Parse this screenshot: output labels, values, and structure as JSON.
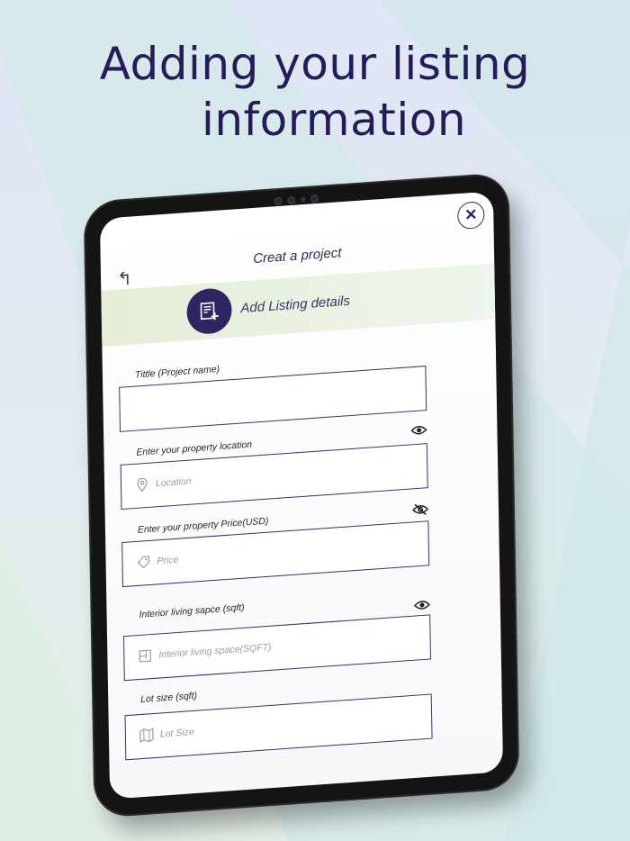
{
  "headline": {
    "line1": "Adding your listing",
    "line2": "information"
  },
  "screen": {
    "title": "Creat a project",
    "banner_text": "Add Listing details",
    "icons": {
      "close": "close-icon",
      "back": "back-arrow-icon",
      "banner": "listing-add-icon"
    }
  },
  "fields": [
    {
      "label": "Tittle (Project name)",
      "placeholder": "",
      "icon": ""
    },
    {
      "label": "Enter your property location",
      "placeholder": "Location",
      "icon": "location-pin-icon",
      "eye": "eye-icon"
    },
    {
      "label": "Enter your property Price(USD)",
      "placeholder": "Price",
      "icon": "price-tag-icon",
      "eye": "eye-off-icon"
    },
    {
      "label": "Interior living sapce (sqft)",
      "placeholder": "Interior living space(SQFT)",
      "icon": "floor-plan-icon",
      "eye": "eye-icon"
    },
    {
      "label": "Lot size (sqft)",
      "placeholder": "Lot Size",
      "icon": "map-icon"
    }
  ],
  "colors": {
    "brand": "#2f2562",
    "headline": "#261a57",
    "banner": "#e4eed8"
  }
}
